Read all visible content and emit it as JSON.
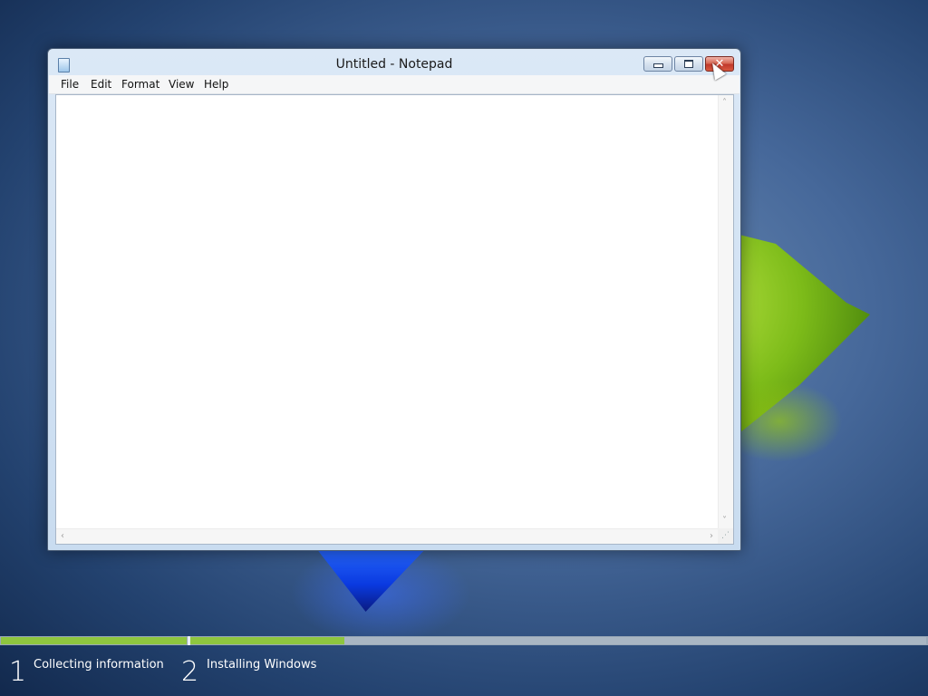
{
  "window": {
    "title": "Untitled - Notepad",
    "menu": [
      "File",
      "Edit",
      "Format",
      "View",
      "Help"
    ],
    "editor_content": "",
    "buttons": {
      "minimize_icon": "minimize-icon",
      "maximize_icon": "maximize-icon",
      "close_icon": "close-icon",
      "close_glyph": "✕"
    },
    "scroll_arrows": {
      "up": "˄",
      "down": "˅",
      "left": "‹",
      "right": "›"
    },
    "grip_glyph": "⋰"
  },
  "setup_progress": {
    "steps": [
      {
        "number": "1",
        "label": "Collecting information",
        "progress": 1.0
      },
      {
        "number": "2",
        "label": "Installing Windows",
        "progress": 0.21
      }
    ],
    "colors": {
      "fill": "#8ec63f",
      "track": "#a9b6c3"
    }
  }
}
